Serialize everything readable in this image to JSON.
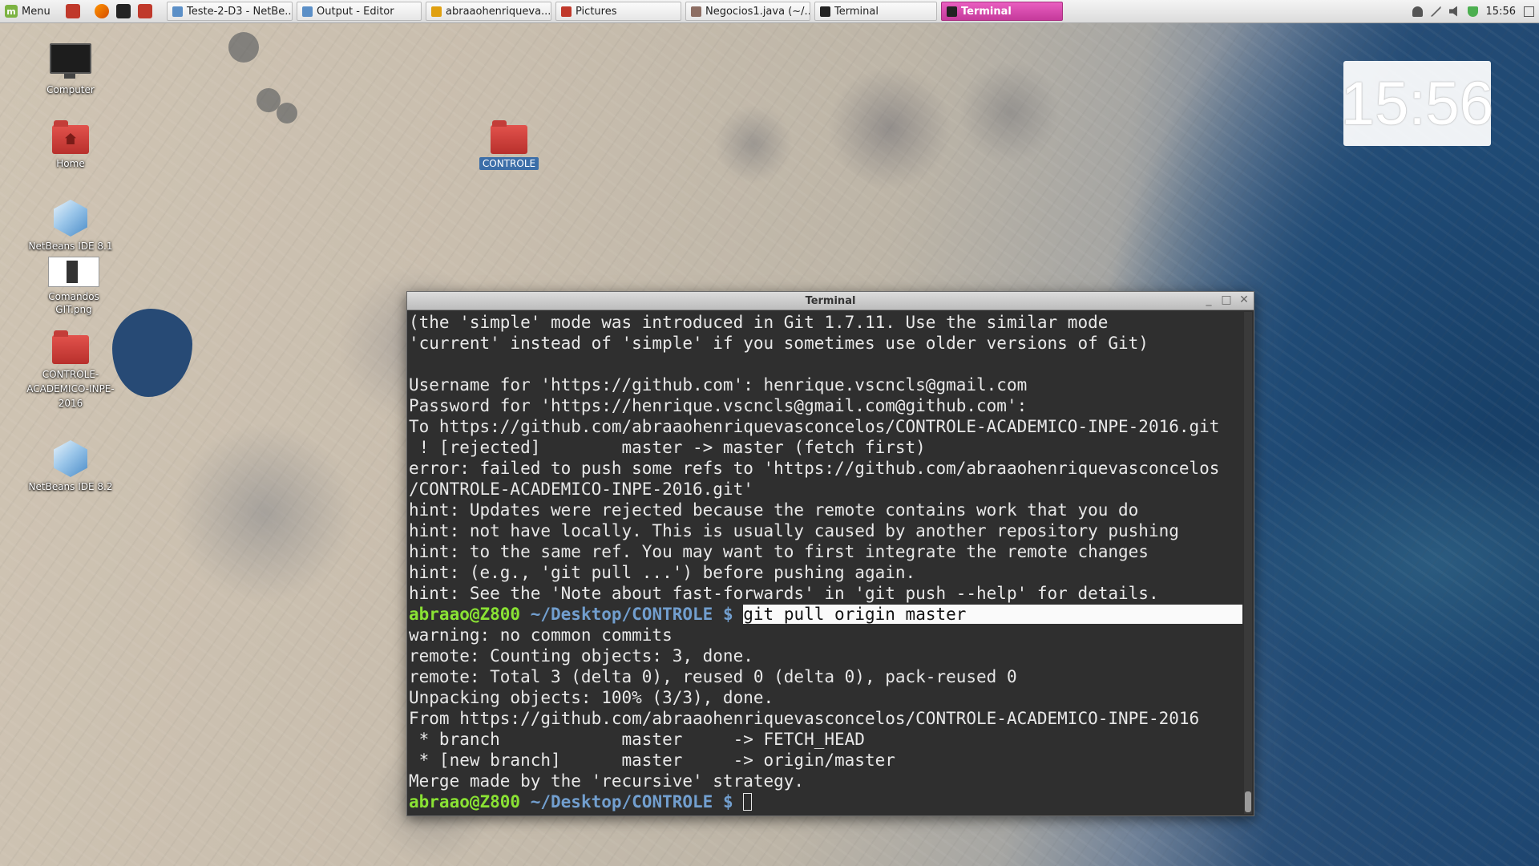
{
  "panel": {
    "menu_label": "Menu",
    "tasks": [
      {
        "label": "Teste-2-D3 - NetBe...",
        "icon": "netbeans-icon"
      },
      {
        "label": "Output - Editor",
        "icon": "netbeans-icon"
      },
      {
        "label": "abraaohenriqueva...",
        "icon": "chrome-icon"
      },
      {
        "label": "Pictures",
        "icon": "folder-icon"
      },
      {
        "label": "Negocios1.java (~/...",
        "icon": "text-editor-icon"
      },
      {
        "label": "Terminal",
        "icon": "terminal-icon"
      },
      {
        "label": "Terminal",
        "icon": "terminal-icon",
        "active": true
      }
    ],
    "clock": "15:56"
  },
  "desktop_clock": "15:56",
  "desktop": {
    "icons": {
      "computer": "Computer",
      "home": "Home",
      "netbeans81": "NetBeans IDE 8.1",
      "comandos": "Comandos GIT.png",
      "controle_academico": "CONTROLE-\nACADEMICO-INPE-\n2016",
      "netbeans82": "NetBeans IDE 8.2",
      "controle": "CONTROLE"
    }
  },
  "terminal": {
    "title": "Terminal",
    "prompt_user": "abraao@Z800",
    "prompt_path": "~/Desktop/CONTROLE $",
    "output_before": [
      "(the 'simple' mode was introduced in Git 1.7.11. Use the similar mode",
      "'current' instead of 'simple' if you sometimes use older versions of Git)",
      "",
      "Username for 'https://github.com': henrique.vscncls@gmail.com",
      "Password for 'https://henrique.vscncls@gmail.com@github.com':",
      "To https://github.com/abraaohenriquevasconcelos/CONTROLE-ACADEMICO-INPE-2016.git",
      " ! [rejected]        master -> master (fetch first)",
      "error: failed to push some refs to 'https://github.com/abraaohenriquevasconcelos",
      "/CONTROLE-ACADEMICO-INPE-2016.git'",
      "hint: Updates were rejected because the remote contains work that you do",
      "hint: not have locally. This is usually caused by another repository pushing",
      "hint: to the same ref. You may want to first integrate the remote changes",
      "hint: (e.g., 'git pull ...') before pushing again.",
      "hint: See the 'Note about fast-forwards' in 'git push --help' for details."
    ],
    "command": "git pull origin master",
    "output_after": [
      "warning: no common commits",
      "remote: Counting objects: 3, done.",
      "remote: Total 3 (delta 0), reused 0 (delta 0), pack-reused 0",
      "Unpacking objects: 100% (3/3), done.",
      "From https://github.com/abraaohenriquevasconcelos/CONTROLE-ACADEMICO-INPE-2016",
      " * branch            master     -> FETCH_HEAD",
      " * [new branch]      master     -> origin/master",
      "Merge made by the 'recursive' strategy."
    ]
  }
}
